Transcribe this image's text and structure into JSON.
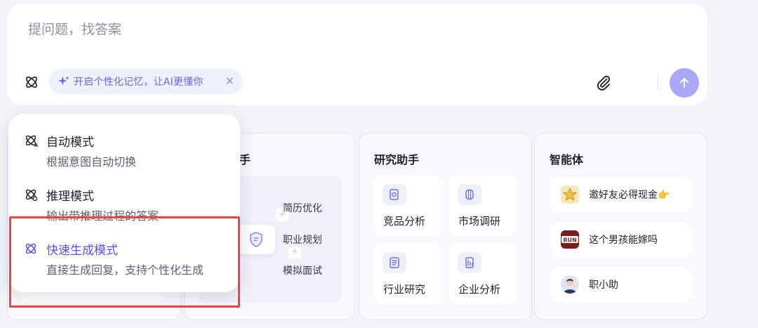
{
  "input": {
    "placeholder": "提问题，找答案",
    "memory_chip_label": "开启个性化记忆，让AI更懂你",
    "memory_chip_close": "×"
  },
  "colors": {
    "accent": "#5b4ef0",
    "send_button": "#aaa7f7",
    "highlight_border": "#e84545",
    "chip_bg": "#eef0fc"
  },
  "cards": {
    "resume": {
      "title_partial": "手",
      "items": [
        "简历优化",
        "职业规划",
        "模拟面试"
      ]
    },
    "research": {
      "title": "研究助手",
      "tiles": [
        {
          "label": "竞品分析",
          "icon": "document-search-icon"
        },
        {
          "label": "市场调研",
          "icon": "cylinder-icon"
        },
        {
          "label": "行业研究",
          "icon": "report-icon"
        },
        {
          "label": "企业分析",
          "icon": "building-report-icon"
        }
      ]
    },
    "agents": {
      "title": "智能体",
      "items": [
        {
          "label": "邀好友必得现金👉",
          "icon": "star-badge-icon"
        },
        {
          "label": "这个男孩能嫁吗",
          "icon": "run-avatar-icon"
        },
        {
          "label": "职小助",
          "icon": "assistant-avatar-icon"
        }
      ]
    }
  },
  "mode_menu": {
    "items": [
      {
        "title": "自动模式",
        "desc": "根据意图自动切换",
        "active": false
      },
      {
        "title": "推理模式",
        "desc": "输出带推理过程的答案",
        "active": false
      },
      {
        "title": "快速生成模式",
        "desc": "直接生成回复，支持个性化生成",
        "active": true
      }
    ]
  }
}
